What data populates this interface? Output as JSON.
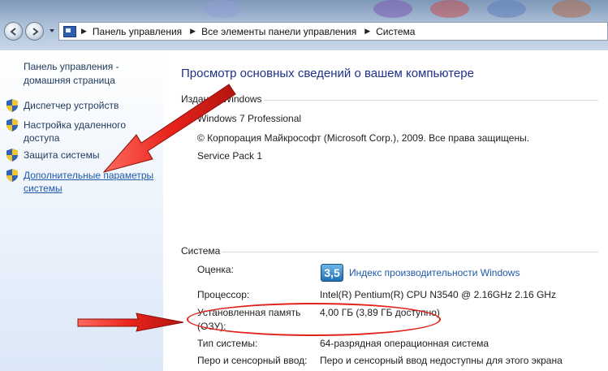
{
  "address_bar": {
    "breadcrumbs": [
      "Панель управления",
      "Все элементы панели управления",
      "Система"
    ]
  },
  "left_pane": {
    "home_link": "Панель управления - домашняя страница",
    "items": [
      {
        "label": "Диспетчер устройств",
        "icon": "shield-icon"
      },
      {
        "label": "Настройка удаленного доступа",
        "icon": "shield-icon"
      },
      {
        "label": "Защита системы",
        "icon": "shield-icon"
      },
      {
        "label": "Дополнительные параметры системы",
        "icon": "shield-icon",
        "highlighted": true
      }
    ]
  },
  "main": {
    "title": "Просмотр основных сведений о вашем компьютере",
    "edition": {
      "heading": "Издание Windows",
      "name": "Windows 7 Professional",
      "copyright": "© Корпорация Майкрософт (Microsoft Corp.), 2009. Все права защищены.",
      "service_pack": "Service Pack 1"
    },
    "system": {
      "heading": "Система",
      "rating_label": "Оценка:",
      "rating_score": "3,5",
      "rating_link": "Индекс производительности Windows",
      "processor_label": "Процессор:",
      "processor_value": "Intel(R) Pentium(R) CPU  N3540  @ 2.16GHz   2.16 GHz",
      "memory_label": "Установленная память (ОЗУ):",
      "memory_value": "4,00 ГБ (3,89 ГБ доступно)",
      "type_label": "Тип системы:",
      "type_value": "64-разрядная операционная система",
      "pen_label": "Перо и сенсорный ввод:",
      "pen_value": "Перо и сенсорный ввод недоступны для этого экрана"
    }
  },
  "colors": {
    "title": "#1e3287",
    "link": "#1e5aa8",
    "annotation_red": "#e2211b"
  }
}
